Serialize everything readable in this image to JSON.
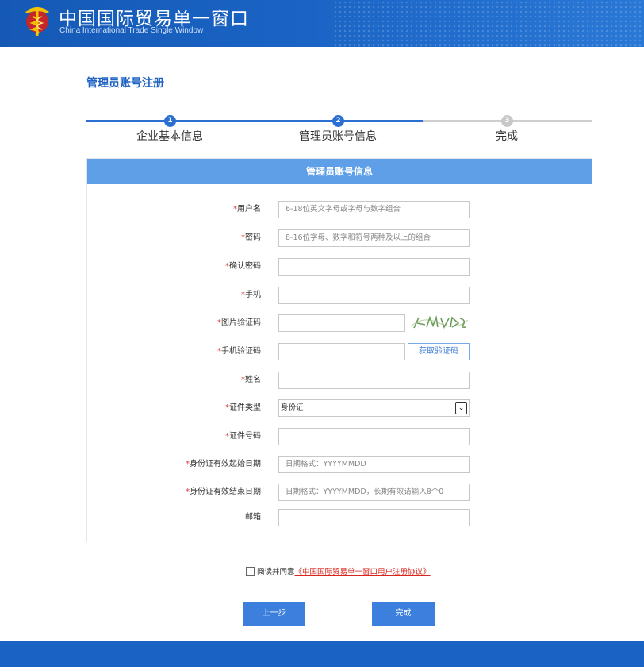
{
  "header": {
    "title": "中国国际贸易单一窗口",
    "subtitle": "China International Trade Single Window",
    "logo_icon": "caduceus-emblem-icon"
  },
  "page": {
    "title": "管理员账号注册"
  },
  "steps": [
    {
      "number": "1",
      "label": "企业基本信息",
      "state": "done"
    },
    {
      "number": "2",
      "label": "管理员账号信息",
      "state": "active"
    },
    {
      "number": "3",
      "label": "完成",
      "state": "pending"
    }
  ],
  "form": {
    "heading": "管理员账号信息",
    "required_mark": "*",
    "fields": [
      {
        "label": "用户名",
        "required": true,
        "placeholder": "6-18位英文字母或字母与数字组合",
        "value": ""
      },
      {
        "label": "密码",
        "required": true,
        "placeholder": "8-16位字母、数字和符号两种及以上的组合",
        "value": ""
      },
      {
        "label": "确认密码",
        "required": true,
        "placeholder": "",
        "value": ""
      },
      {
        "label": "手机",
        "required": true,
        "placeholder": "",
        "value": ""
      },
      {
        "label": "图片验证码",
        "required": true,
        "placeholder": "",
        "value": ""
      },
      {
        "label": "手机验证码",
        "required": true,
        "placeholder": "",
        "value": ""
      },
      {
        "label": "姓名",
        "required": true,
        "placeholder": "",
        "value": ""
      },
      {
        "label": "证件类型",
        "required": true,
        "placeholder": "",
        "value": "身份证"
      },
      {
        "label": "证件号码",
        "required": true,
        "placeholder": "",
        "value": ""
      },
      {
        "label": "身份证有效起始日期",
        "required": true,
        "placeholder": "日期格式：YYYYMMDD",
        "value": ""
      },
      {
        "label": "身份证有效结束日期",
        "required": true,
        "placeholder": "日期格式：YYYYMMDD，长期有效请输入8个0",
        "value": ""
      },
      {
        "label": "邮箱",
        "required": false,
        "placeholder": "",
        "value": ""
      }
    ],
    "sms_button": "获取验证码"
  },
  "agreement": {
    "prefix": "阅读并同意",
    "link": "《中国国际贸易单一窗口用户注册协议》"
  },
  "actions": {
    "prev": "上一步",
    "finish": "完成"
  },
  "colors": {
    "brand_blue": "#1a63c4",
    "panel_head": "#5e9fe8",
    "required_red": "#e23c3c",
    "link_red": "#d9261c"
  }
}
